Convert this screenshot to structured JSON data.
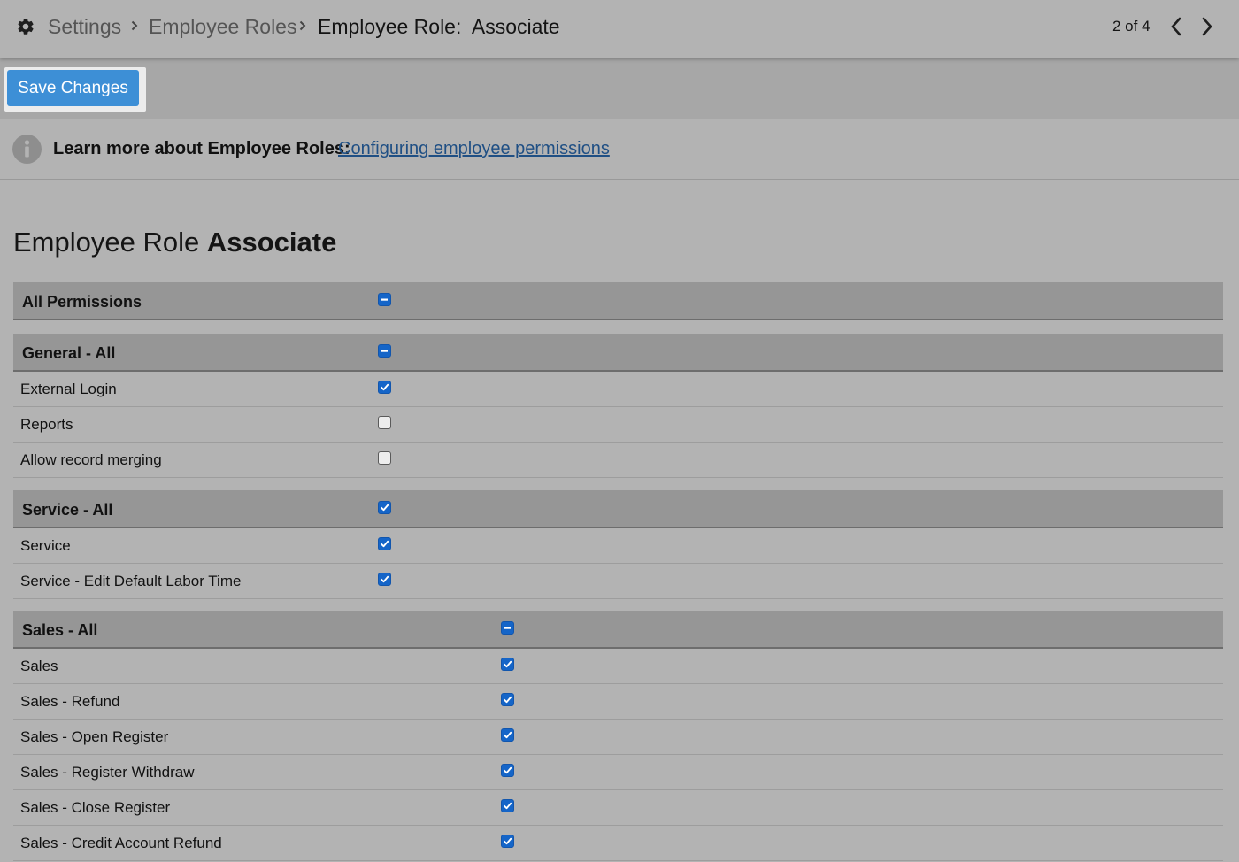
{
  "breadcrumb": {
    "items": [
      {
        "label": "Settings"
      },
      {
        "label": "Employee Roles"
      },
      {
        "label": "Employee Role:  Associate"
      }
    ],
    "icon": "gear-icon",
    "separator_icon": "chevron-right-icon"
  },
  "pager": {
    "count_text": "2 of 4",
    "prev_icon": "chevron-left-icon",
    "next_icon": "chevron-right-icon"
  },
  "toolbar": {
    "save_label": "Save Changes",
    "save_color": "#3d8fd6"
  },
  "info": {
    "icon": "info-icon",
    "label": "Learn more about Employee Roles:",
    "link_text": "Configuring employee permissions",
    "link_color": "#1f4f84"
  },
  "page_title": {
    "prefix": "Employee Role",
    "role": "Associate"
  },
  "checkbox_color": "#1565c8",
  "sections": [
    {
      "header": {
        "label": "All Permissions",
        "state": "indeterminate"
      },
      "rows": []
    },
    {
      "header": {
        "label": "General - All",
        "state": "indeterminate"
      },
      "rows": [
        {
          "label": "External Login",
          "state": "checked"
        },
        {
          "label": "Reports",
          "state": "unchecked"
        },
        {
          "label": "Allow record merging",
          "state": "unchecked"
        }
      ]
    },
    {
      "header": {
        "label": "Service - All",
        "state": "checked"
      },
      "rows": [
        {
          "label": "Service",
          "state": "checked"
        },
        {
          "label": "Service - Edit Default Labor Time",
          "state": "checked"
        }
      ]
    },
    {
      "header": {
        "label": "Sales - All",
        "state": "indeterminate"
      },
      "rows": [
        {
          "label": "Sales",
          "state": "checked"
        },
        {
          "label": "Sales - Refund",
          "state": "checked"
        },
        {
          "label": "Sales - Open Register",
          "state": "checked"
        },
        {
          "label": "Sales - Register Withdraw",
          "state": "checked"
        },
        {
          "label": "Sales - Close Register",
          "state": "checked"
        },
        {
          "label": "Sales - Credit Account Refund",
          "state": "checked"
        }
      ]
    }
  ]
}
